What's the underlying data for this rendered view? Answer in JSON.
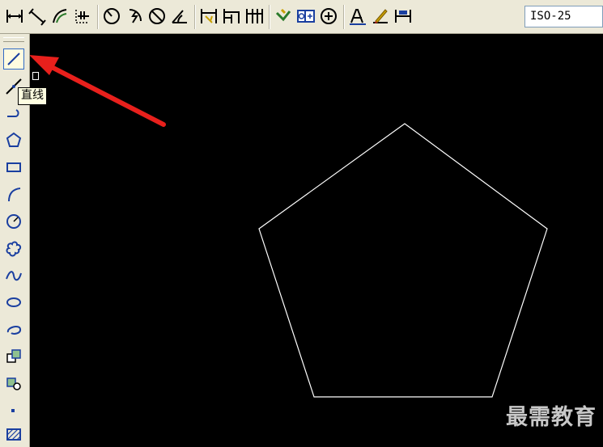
{
  "toolbar_top": {
    "dim_style": "ISO-25",
    "buttons": [
      {
        "name": "linear-dimension-icon"
      },
      {
        "name": "aligned-dimension-icon"
      },
      {
        "name": "arc-length-icon"
      },
      {
        "name": "ordinate-dimension-icon"
      },
      {
        "name": "radius-dimension-icon"
      },
      {
        "name": "jogged-dimension-icon"
      },
      {
        "name": "diameter-dimension-icon"
      },
      {
        "name": "angular-dimension-icon"
      },
      {
        "name": "quick-dimension-icon"
      },
      {
        "name": "baseline-dimension-icon"
      },
      {
        "name": "continue-dimension-icon"
      },
      {
        "name": "quick-leader-icon"
      },
      {
        "name": "tolerance-icon"
      },
      {
        "name": "center-mark-icon"
      },
      {
        "name": "dimension-edit-icon"
      },
      {
        "name": "dimension-text-edit-icon"
      },
      {
        "name": "dimension-update-icon"
      }
    ]
  },
  "toolbar_left": {
    "tooltip": "直线",
    "buttons": [
      "line-icon",
      "construction-line-icon",
      "polyline-icon",
      "polygon-icon",
      "rectangle-icon",
      "arc-icon",
      "circle-icon",
      "revision-cloud-icon",
      "spline-icon",
      "ellipse-icon",
      "ellipse-arc-icon",
      "insert-block-icon",
      "make-block-icon",
      "point-icon",
      "hatch-icon"
    ]
  },
  "watermark": "最需教育",
  "colors": {
    "canvas": "#000000",
    "line": "#ffffff",
    "arrow": "#e8201c",
    "toolbar": "#ece9d8"
  }
}
